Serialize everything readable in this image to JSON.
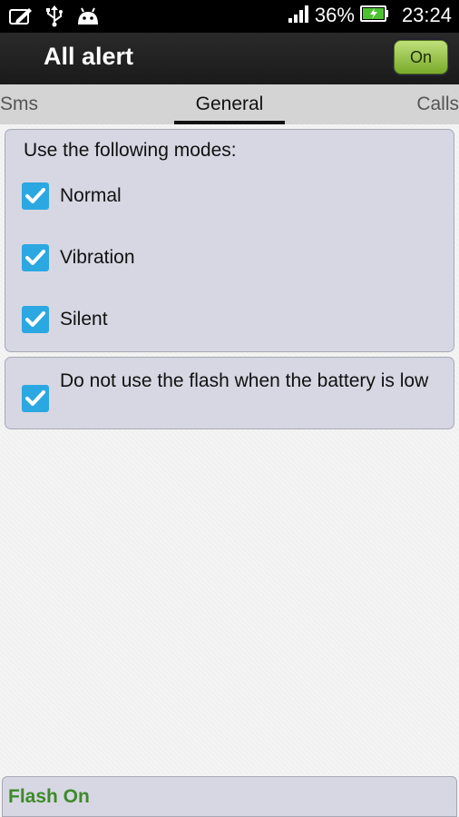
{
  "statusbar": {
    "battery_percent": "36%",
    "time": "23:24",
    "icons": [
      "edit-icon",
      "usb-icon",
      "android-icon",
      "signal-icon",
      "battery-charging-icon"
    ]
  },
  "actionbar": {
    "title": "All alert",
    "toggle_label": "On"
  },
  "tabs": {
    "items": [
      {
        "label": "Sms",
        "selected": false
      },
      {
        "label": "General",
        "selected": true
      },
      {
        "label": "Calls",
        "selected": false
      }
    ]
  },
  "modes": {
    "heading": "Use the following modes:",
    "items": [
      {
        "label": "Normal",
        "checked": true
      },
      {
        "label": "Vibration",
        "checked": true
      },
      {
        "label": "Silent",
        "checked": true
      }
    ]
  },
  "battery_option": {
    "label": "Do not use the flash when the battery is low",
    "checked": true
  },
  "footer": {
    "status": "Flash On"
  },
  "colors": {
    "checkbox": "#2ba8e2",
    "toggle_green": "#79aa2a",
    "status_green": "#3d8a2a",
    "card_bg": "#d6d7e3"
  }
}
